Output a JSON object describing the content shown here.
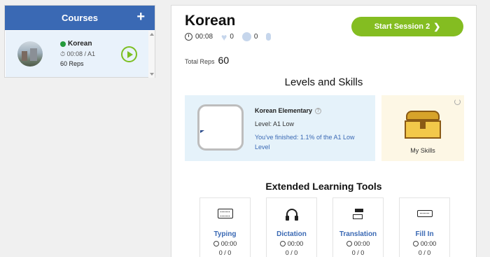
{
  "courses_panel": {
    "title": "Courses",
    "add_label": "+",
    "items": [
      {
        "name": "Korean",
        "meta": "00:08 / A1",
        "reps": "60 Reps",
        "status_color": "#239a3b"
      }
    ]
  },
  "course": {
    "title": "Korean",
    "time": "00:08",
    "likes": "0",
    "smiles": "0",
    "start_button": "Start Session 2",
    "total_reps_label": "Total Reps",
    "total_reps_value": "60"
  },
  "levels": {
    "section_title": "Levels and Skills",
    "level_name": "Korean Elementary",
    "level_label": "Level: A1 Low",
    "progress_text": "You've finished: 1.1% of the A1 Low Level",
    "progress_fraction": 0.011,
    "skills_label": "My Skills"
  },
  "tools": {
    "section_title": "Extended Learning Tools",
    "items": [
      {
        "name": "Typing",
        "time": "00:00",
        "count": "0 / 0",
        "icon": "keyboard-icon"
      },
      {
        "name": "Dictation",
        "time": "00:00",
        "count": "0 / 0",
        "icon": "headphones-icon"
      },
      {
        "name": "Translation",
        "time": "00:00",
        "count": "0 / 0",
        "icon": "translation-icon"
      },
      {
        "name": "Fill In",
        "time": "00:00",
        "count": "0 / 0",
        "icon": "fill-in-icon"
      }
    ]
  },
  "colors": {
    "header_blue": "#3a69b4",
    "accent_green": "#84bd21",
    "level_bg": "#e5f2fa",
    "skills_bg": "#fdf7e5"
  }
}
